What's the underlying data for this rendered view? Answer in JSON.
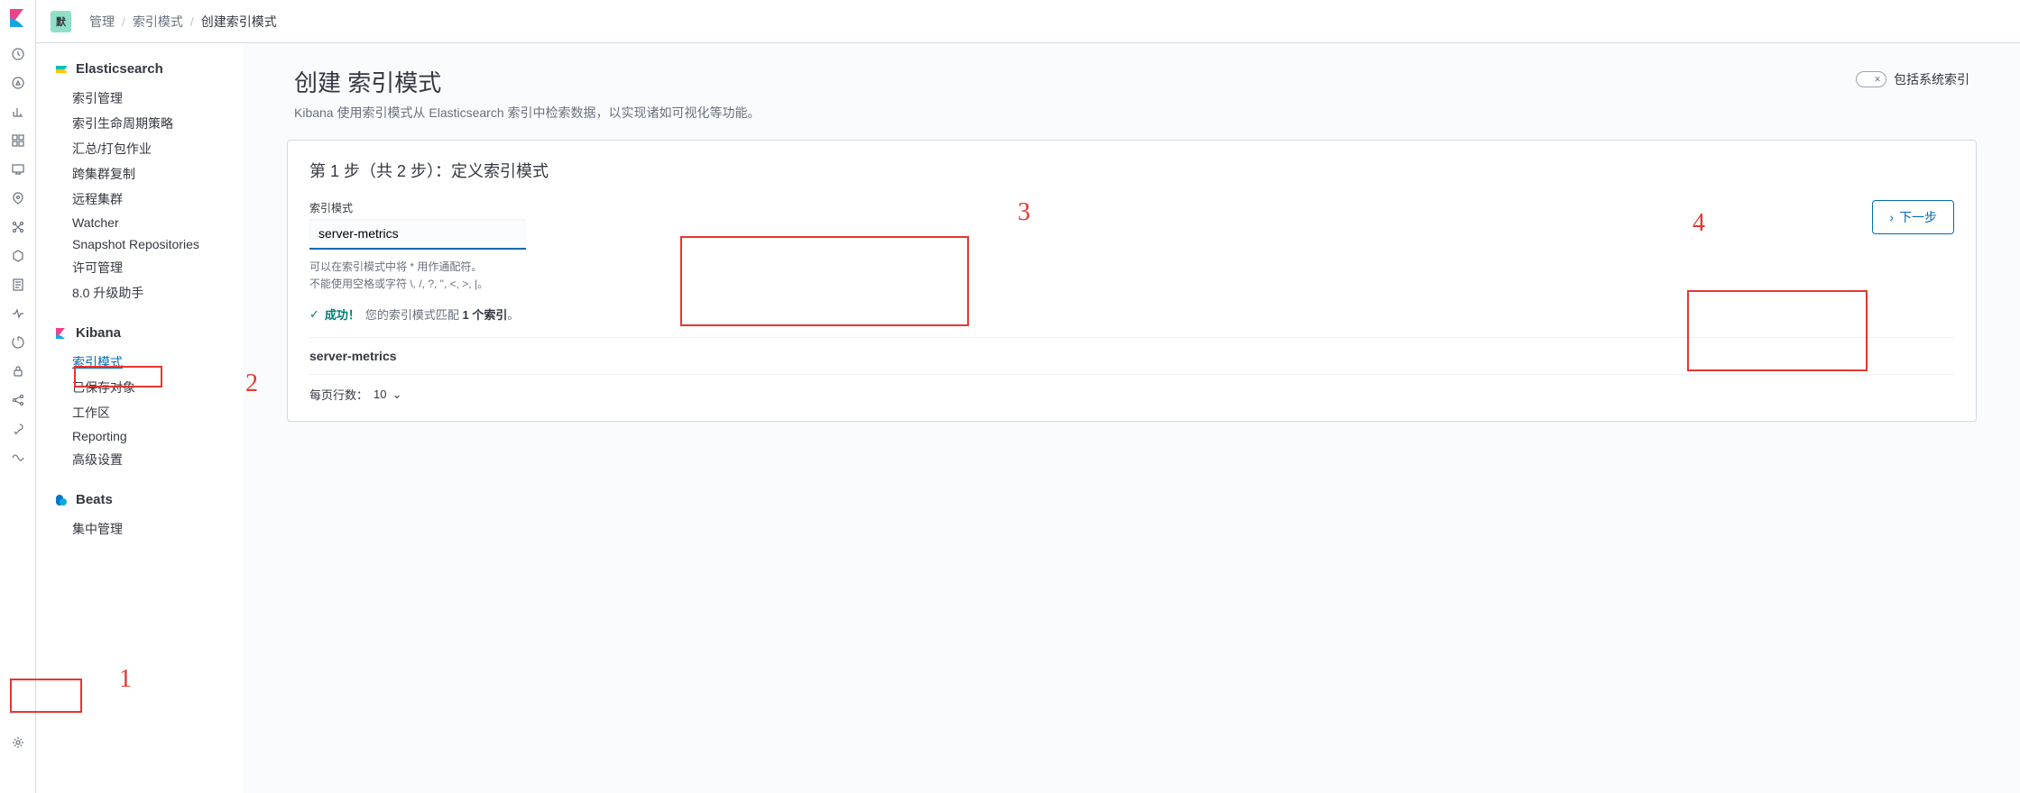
{
  "header": {
    "space_badge": "默",
    "breadcrumbs": [
      "管理",
      "索引模式",
      "创建索引模式"
    ]
  },
  "sidebar": {
    "sections": [
      {
        "title": "Elasticsearch",
        "items": [
          {
            "label": "索引管理",
            "active": false
          },
          {
            "label": "索引生命周期策略",
            "active": false
          },
          {
            "label": "汇总/打包作业",
            "active": false
          },
          {
            "label": "跨集群复制",
            "active": false
          },
          {
            "label": "远程集群",
            "active": false
          },
          {
            "label": "Watcher",
            "active": false
          },
          {
            "label": "Snapshot Repositories",
            "active": false
          },
          {
            "label": "许可管理",
            "active": false
          },
          {
            "label": "8.0 升级助手",
            "active": false
          }
        ]
      },
      {
        "title": "Kibana",
        "items": [
          {
            "label": "索引模式",
            "active": true
          },
          {
            "label": "已保存对象",
            "active": false
          },
          {
            "label": "工作区",
            "active": false
          },
          {
            "label": "Reporting",
            "active": false
          },
          {
            "label": "高级设置",
            "active": false
          }
        ]
      },
      {
        "title": "Beats",
        "items": [
          {
            "label": "集中管理",
            "active": false
          }
        ]
      }
    ]
  },
  "content": {
    "title": "创建 索引模式",
    "subtitle": "Kibana 使用索引模式从 Elasticsearch 索引中检索数据，以实现诸如可视化等功能。",
    "toggle_label": "包括系统索引",
    "step_title": "第 1 步（共 2 步）：定义索引模式",
    "field_label": "索引模式",
    "field_value": "server-metrics",
    "help1": "可以在索引模式中将 * 用作通配符。",
    "help2": "不能使用空格或字符 \\, /, ?, \", <, >, |。",
    "success_label": "成功！",
    "success_msg_pre": "您的索引模式匹配 ",
    "success_msg_bold": "1 个索引",
    "success_msg_post": "。",
    "next_btn": "下一步",
    "match_item": "server-metrics",
    "pager_label": "每页行数：",
    "pager_value": "10"
  },
  "annotations": {
    "a1": "1",
    "a2": "2",
    "a3": "3",
    "a4": "4"
  }
}
